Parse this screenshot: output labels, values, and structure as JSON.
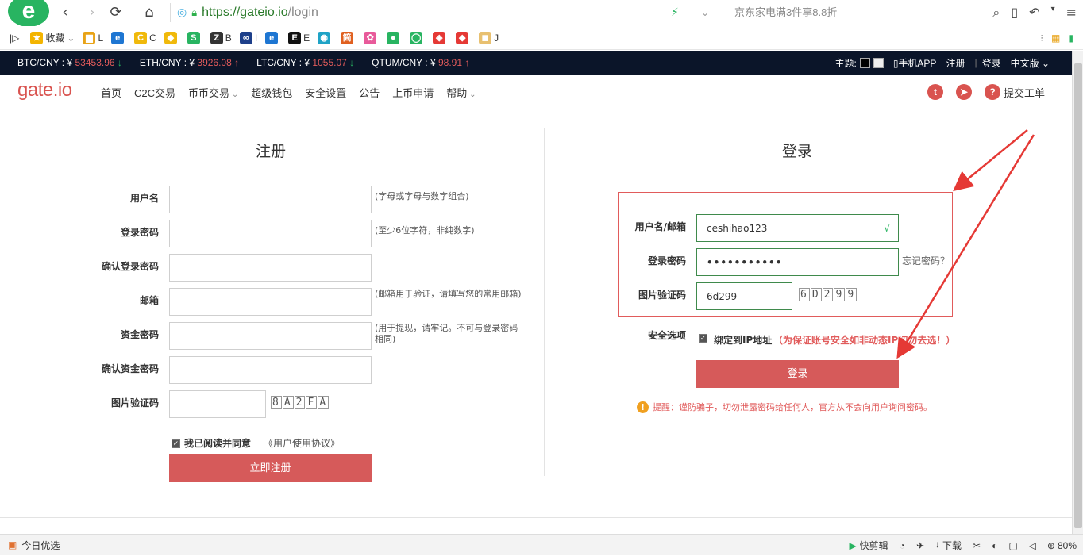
{
  "browser": {
    "logo_glyph": "e",
    "url_scheme_host": "https://gateio.io",
    "url_path": "/login",
    "search_promo": "京东家电满3件享8.8折"
  },
  "bookmarks": [
    {
      "label": "收藏",
      "icon": "star-icon"
    },
    {
      "label": "L",
      "icon": "folder-icon"
    },
    {
      "label": "",
      "icon": "ie-icon"
    },
    {
      "label": "C",
      "icon": "c-icon"
    },
    {
      "label": "",
      "icon": "binance-icon"
    },
    {
      "label": "",
      "icon": "app-icon"
    },
    {
      "label": "B",
      "icon": "z-icon"
    },
    {
      "label": "I",
      "icon": "infinity-icon"
    },
    {
      "label": "",
      "icon": "ie2-icon"
    },
    {
      "label": "E",
      "icon": "e-icon"
    },
    {
      "label": "",
      "icon": "round-icon"
    },
    {
      "label": "",
      "icon": "jian-icon"
    },
    {
      "label": "",
      "icon": "pinwheel-icon"
    },
    {
      "label": "",
      "icon": "wechat-icon"
    },
    {
      "label": "",
      "icon": "ring-icon"
    },
    {
      "label": "",
      "icon": "diamond-icon"
    },
    {
      "label": "",
      "icon": "shield-icon"
    },
    {
      "label": "J",
      "icon": "j-icon"
    }
  ],
  "ticker": [
    {
      "pair": "BTC/CNY :",
      "currency": "¥",
      "price": "53453.96",
      "dir": "↓"
    },
    {
      "pair": "ETH/CNY :",
      "currency": "¥",
      "price": "3926.08",
      "dir": "↑"
    },
    {
      "pair": "LTC/CNY :",
      "currency": "¥",
      "price": "1055.07",
      "dir": "↓"
    },
    {
      "pair": "QTUM/CNY :",
      "currency": "¥",
      "price": "98.91",
      "dir": "↑"
    }
  ],
  "ticker_right": {
    "theme_label": "主题:",
    "mobile_app": "手机APP",
    "register": "注册",
    "login": "登录",
    "language": "中文版"
  },
  "site": {
    "logo": "gate.io",
    "nav": [
      "首页",
      "C2C交易",
      "币币交易",
      "超级钱包",
      "安全设置",
      "公告",
      "上币申请",
      "帮助"
    ],
    "submit_ticket": "提交工单"
  },
  "register": {
    "title": "注册",
    "fields": [
      {
        "label": "用户名",
        "hint": "(字母或字母与数字组合)"
      },
      {
        "label": "登录密码",
        "hint": "(至少6位字符，非纯数字)"
      },
      {
        "label": "确认登录密码",
        "hint": ""
      },
      {
        "label": "邮箱",
        "hint": "(邮箱用于验证，请填写您的常用邮箱)"
      },
      {
        "label": "资金密码",
        "hint": "(用于提现，请牢记。不可与登录密码相同)"
      },
      {
        "label": "确认资金密码",
        "hint": ""
      },
      {
        "label": "图片验证码",
        "hint": ""
      }
    ],
    "captcha": "8A2FA",
    "agree_text": "我已阅读并同意",
    "agreement_link": "《用户使用协议》",
    "submit": "立即注册"
  },
  "login": {
    "title": "登录",
    "username_label": "用户名/邮箱",
    "username_value": "ceshihao123",
    "username_check": "√",
    "password_label": "登录密码",
    "password_value": "•••••••••••",
    "forgot": "忘记密码？",
    "captcha_label": "图片验证码",
    "captcha_value": "6d299",
    "captcha_image": "6D299",
    "security_label": "安全选项",
    "bind_ip": "绑定到IP地址",
    "bind_ip_note": "（为保证账号安全如非动态IP切勿去选！）",
    "submit": "登录",
    "warning": "提醒：谨防骗子，切勿泄露密码给任何人，官方从不会向用户询问密码。"
  },
  "statusbar": {
    "left": "今日优选",
    "clip": "快剪辑",
    "download": "下载",
    "zoom": "80%"
  },
  "colors": {
    "brand_red": "#d65a5a",
    "ticker_bg": "#0b1529",
    "up_red": "#e15b5b",
    "down_green": "#28b461",
    "annotation_red": "#e53935"
  }
}
